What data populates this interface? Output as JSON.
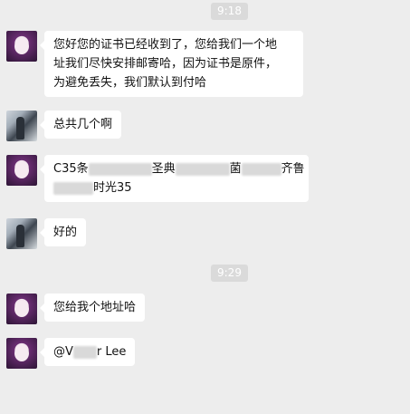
{
  "chat": {
    "timestamps": [
      "9:18",
      "9:29"
    ],
    "messages": [
      {
        "sender": "contact-a",
        "lines": [
          "您好您的证书已经收到了，您给我们一个地",
          "址我们尽快安排邮寄哈，因为证书是原件，",
          "为避免丢失，我们默认到付哈"
        ]
      },
      {
        "sender": "contact-b",
        "text": "总共几个啊"
      },
      {
        "sender": "contact-a",
        "line1_start": "C35条",
        "line1_mid": "圣典",
        "line1_mid2": "菌",
        "line1_end": "齐鲁",
        "line2_end": "时光35"
      },
      {
        "sender": "contact-b",
        "text": "好的"
      },
      {
        "sender": "contact-a",
        "text": "您给我个地址哈"
      },
      {
        "sender": "contact-a",
        "mention_start": "@V",
        "mention_end": "r Lee"
      }
    ]
  }
}
